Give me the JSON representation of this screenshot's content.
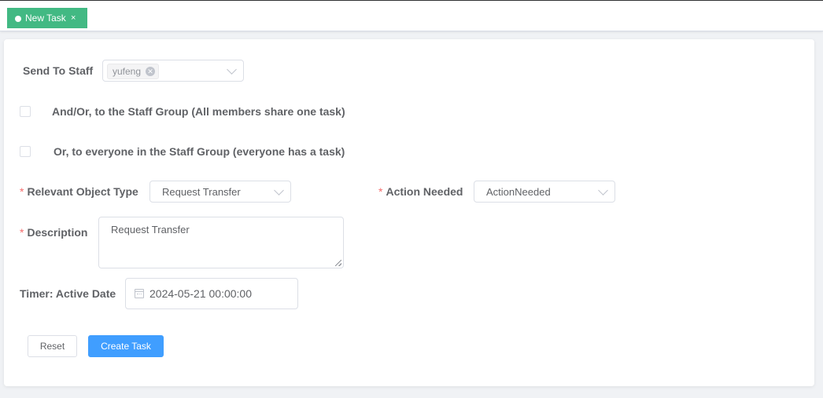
{
  "tabs": [
    {
      "label": "New Task",
      "close": "×",
      "active": true
    }
  ],
  "form": {
    "send_to_staff": {
      "label": "Send To Staff",
      "tags": [
        "yufeng"
      ]
    },
    "staff_group_share": {
      "label": "And/Or, to the Staff Group (All members share one task)",
      "checked": false
    },
    "staff_group_everyone": {
      "label": "Or, to everyone in the Staff Group (everyone has a task)",
      "checked": false
    },
    "relevant_object_type": {
      "required_mark": "*",
      "label": "Relevant Object Type",
      "value": "Request Transfer"
    },
    "action_needed": {
      "required_mark": "*",
      "label": "Action Needed",
      "value": "ActionNeeded"
    },
    "description": {
      "required_mark": "*",
      "label": "Description",
      "value": "Request Transfer"
    },
    "timer_active_date": {
      "label": "Timer: Active Date",
      "value": "2024-05-21 00:00:00"
    }
  },
  "buttons": {
    "reset": "Reset",
    "create": "Create Task"
  },
  "colors": {
    "tab_active": "#42b983",
    "primary": "#409eff",
    "required": "#f56c6c"
  },
  "icons": {
    "tab_dot": "dot-icon",
    "tab_close": "close-icon",
    "tag_close": "circle-close-icon",
    "select_arrow": "chevron-down-icon",
    "date": "calendar-icon"
  }
}
